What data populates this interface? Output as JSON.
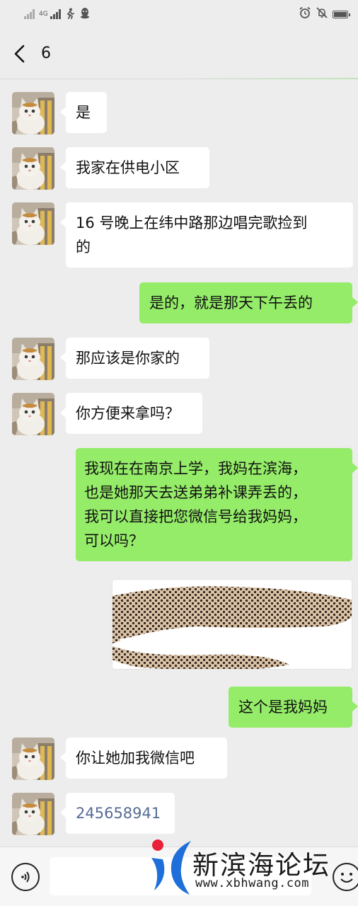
{
  "status_bar": {
    "network_label": "4G",
    "icons": [
      "signal-icon",
      "signal-icon",
      "activity-icon",
      "qq-icon",
      "alarm-icon",
      "silent-icon",
      "battery-icon"
    ]
  },
  "header": {
    "title": "6",
    "back_icon": "chevron-left-icon"
  },
  "messages": [
    {
      "side": "in",
      "text": "是"
    },
    {
      "side": "in",
      "text": "我家在供电小区"
    },
    {
      "side": "in",
      "lines": [
        "16 号晚上在纬中路那边唱完歌捡到",
        "的"
      ]
    },
    {
      "side": "out",
      "text": "是的，就是那天下午丢的"
    },
    {
      "side": "in",
      "text": "那应该是你家的"
    },
    {
      "side": "in",
      "text": "你方便来拿吗？"
    },
    {
      "side": "out",
      "lines": [
        "我现在在南京上学，我妈在滨海，",
        "也是她那天去送弟弟补课弄丢的，",
        "我可以直接把您微信号给我妈妈，",
        "可以吗？"
      ]
    },
    {
      "side": "out",
      "type": "image",
      "note": "redacted-image"
    },
    {
      "side": "out",
      "text": "这个是我妈妈"
    },
    {
      "side": "in",
      "text": "你让她加我微信吧"
    },
    {
      "side": "in",
      "text": "245658941",
      "style": "link"
    }
  ],
  "input_bar": {
    "voice_icon": "voice-icon",
    "emoji_icon": "emoji-icon",
    "placeholder": ""
  },
  "watermark": {
    "title": "新滨海论坛",
    "url": "www.xbhwang.com"
  },
  "colors": {
    "background": "#ededed",
    "outgoing_bubble": "#95ec69",
    "incoming_bubble": "#ffffff",
    "link_text": "#576b95",
    "watermark_blue": "#1e6fd9",
    "watermark_red": "#e8203a"
  }
}
